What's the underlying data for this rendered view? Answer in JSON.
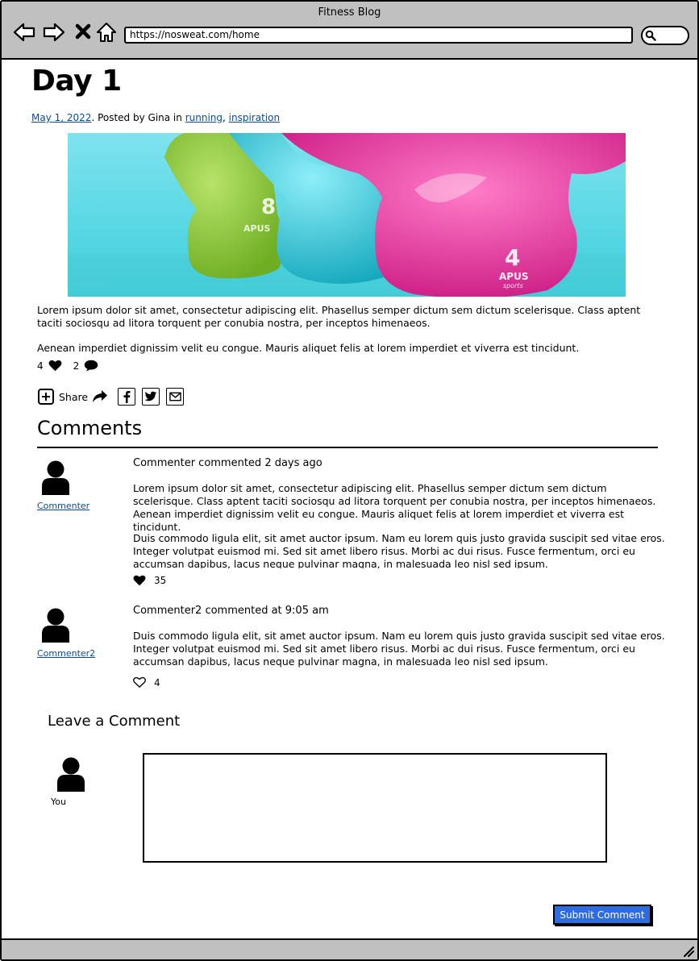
{
  "window": {
    "title": "Fitness Blog",
    "url": "https://nosweat.com/home"
  },
  "post": {
    "title": "Day 1",
    "date": "May 1, 2022",
    "posted_by": ". Posted by Gina in ",
    "tag1": "running",
    "tag_sep": ",",
    "tag2": "inspiration",
    "hero_numbers": {
      "green": "8",
      "pink": "4"
    },
    "hero_brand": "APUS",
    "hero_brand_sub": "sports",
    "paragraph1": "Lorem ipsum dolor sit amet, consectetur adipiscing elit. Phasellus semper dictum sem dictum scelerisque. Class aptent taciti sociosqu ad litora torquent per conubia nostra, per inceptos himenaeos.",
    "paragraph2": "Aenean imperdiet dignissim velit eu congue. Mauris aliquet felis at lorem imperdiet et viverra est tincidunt.",
    "likes": "4",
    "comment_count": "2",
    "share_label": "Share"
  },
  "comments": {
    "heading": "Comments",
    "items": [
      {
        "author": "Commenter",
        "header": "Commenter commented 2 days ago",
        "paragraph1": "Lorem ipsum dolor sit amet, consectetur adipiscing elit. Phasellus semper dictum sem dictum scelerisque. Class aptent taciti sociosqu ad litora torquent per conubia nostra, per inceptos himenaeos. Aenean imperdiet dignissim velit eu congue. Mauris aliquet felis at lorem imperdiet et viverra est tincidunt.",
        "paragraph2": "Duis commodo ligula elit, sit amet auctor ipsum. Nam eu lorem quis justo gravida suscipit sed vitae eros. Integer volutpat euismod mi. Sed sit amet libero risus. Morbi ac dui risus. Fusce fermentum, orci eu accumsan dapibus, lacus neque pulvinar magna, in malesuada leo nisl sed ipsum.",
        "likes": "35"
      },
      {
        "author": "Commenter2",
        "header": "Commenter2 commented at 9:05 am",
        "paragraph1": "Duis commodo ligula elit, sit amet auctor ipsum. Nam eu lorem quis justo gravida suscipit sed vitae eros. Integer volutpat euismod mi. Sed sit amet libero risus. Morbi ac dui risus. Fusce fermentum, orci eu accumsan dapibus, lacus neque pulvinar magna, in malesuada leo nisl sed ipsum.",
        "likes": "4"
      }
    ]
  },
  "leave_comment": {
    "heading": "Leave a Comment",
    "you_label": "You",
    "textarea_value": "",
    "submit_label": "Submit Comment"
  },
  "colors": {
    "chrome": "#c0c0c0",
    "link": "#0b4a9a",
    "submit": "#2f6ce0",
    "hero_bg": "#5ed7e6",
    "kettlebell_green": "#8cc63f",
    "kettlebell_cyan": "#2bbfd0",
    "kettlebell_pink": "#e8259a"
  },
  "icons": [
    "back-arrow-icon",
    "forward-arrow-icon",
    "close-icon",
    "home-icon",
    "search-icon",
    "heart-icon",
    "comment-bubble-icon",
    "plus-box-icon",
    "share-arrow-icon",
    "facebook-icon",
    "twitter-icon",
    "email-icon",
    "user-avatar-icon",
    "heart-outline-icon",
    "resize-grip-icon"
  ]
}
